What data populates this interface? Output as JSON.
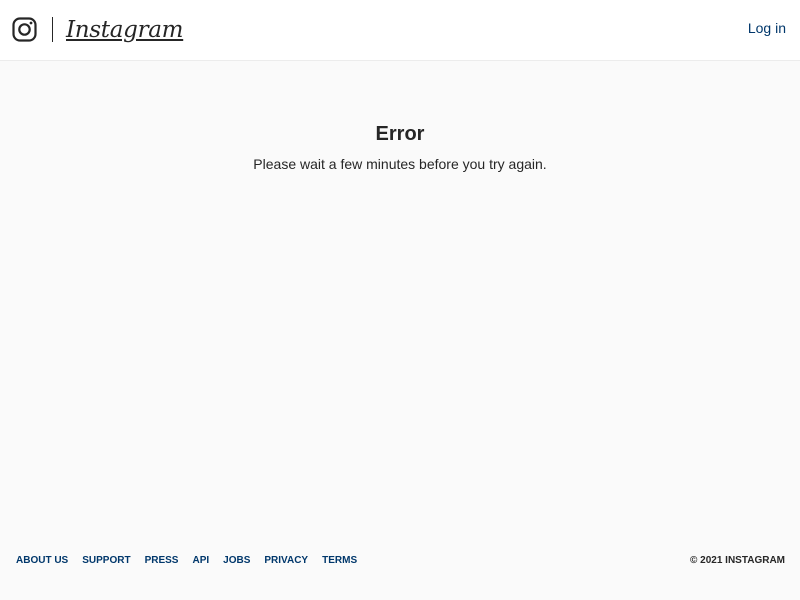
{
  "header": {
    "brand_name": "Instagram",
    "login_label": "Log in"
  },
  "main": {
    "title": "Error",
    "message": "Please wait a few minutes before you try again."
  },
  "footer": {
    "links": [
      {
        "label": "ABOUT US"
      },
      {
        "label": "SUPPORT"
      },
      {
        "label": "PRESS"
      },
      {
        "label": "API"
      },
      {
        "label": "JOBS"
      },
      {
        "label": "PRIVACY"
      },
      {
        "label": "TERMS"
      }
    ],
    "copyright": "© 2021 INSTAGRAM"
  },
  "icons": {
    "logo": "instagram-camera-icon"
  },
  "colors": {
    "link": "#00376b",
    "text": "#262626",
    "background": "#fafafa",
    "header_background": "#ffffff"
  }
}
